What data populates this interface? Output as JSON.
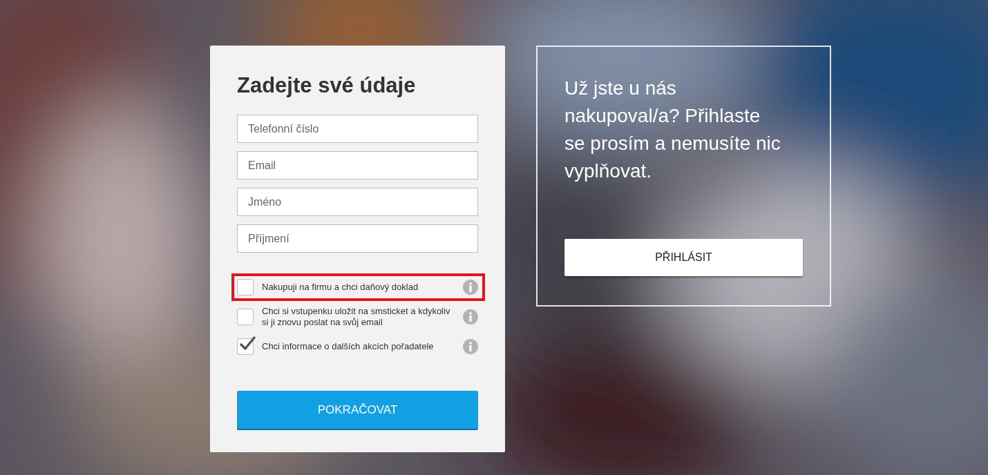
{
  "form": {
    "title": "Zadejte své údaje",
    "fields": [
      {
        "placeholder": "Telefonní číslo"
      },
      {
        "placeholder": "Email"
      },
      {
        "placeholder": "Jméno"
      },
      {
        "placeholder": "Příjmení"
      }
    ],
    "options": [
      {
        "label": "Nakupuji na firmu a chci daňový doklad",
        "checked": false,
        "highlighted": true
      },
      {
        "label": "Chci si vstupenku uložit na smsticket a kdykoliv si ji znovu poslat na svůj email",
        "checked": false,
        "highlighted": false
      },
      {
        "label": "Chci informace o dalších akcích pořadatele",
        "checked": true,
        "highlighted": false
      }
    ],
    "submit": "POKRAČOVAT"
  },
  "login": {
    "text": "Už jste u nás nakupoval/a? Přihlaste se prosím a nemusíte nic vyplňovat.",
    "button": "PŘIHLÁSIT"
  }
}
